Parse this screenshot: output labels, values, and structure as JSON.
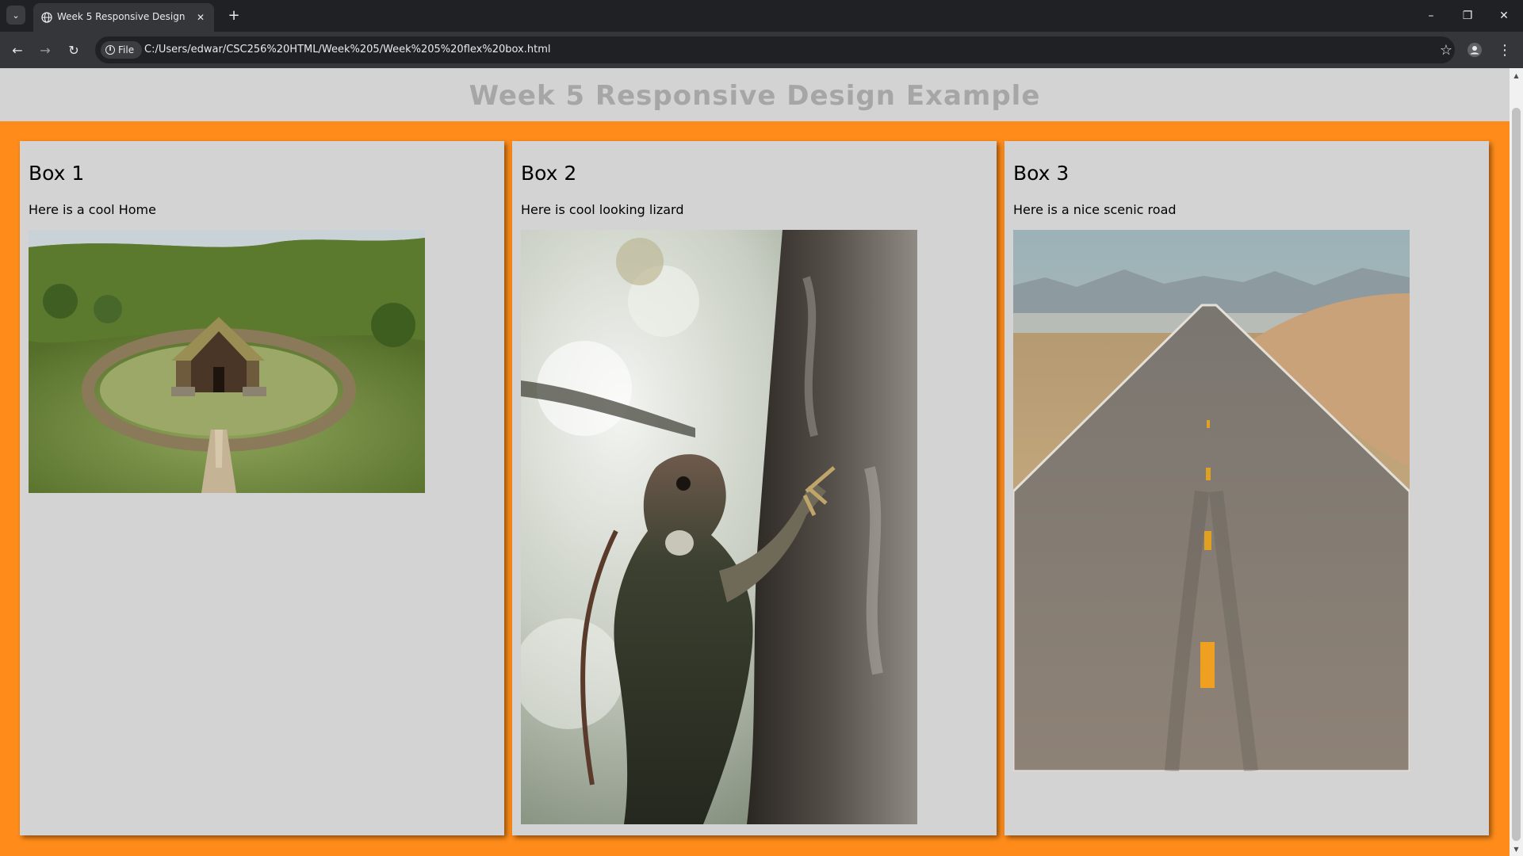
{
  "browser": {
    "tab_title": "Week 5 Responsive Design",
    "url_chip": "File",
    "url": "C:/Users/edwar/CSC256%20HTML/Week%205/Week%205%20flex%20box.html"
  },
  "page": {
    "heading": "Week 5 Responsive Design Example"
  },
  "boxes": [
    {
      "title": "Box 1",
      "caption": "Here is a cool Home",
      "image": "turf-house-photo"
    },
    {
      "title": "Box 2",
      "caption": "Here is cool looking lizard",
      "image": "iguana-photo"
    },
    {
      "title": "Box 3",
      "caption": "Here is a nice scenic road",
      "image": "desert-road-photo"
    }
  ],
  "colors": {
    "container_background": "#ff8c1a",
    "box_background": "#d3d3d3",
    "heading_color": "#a6a6a6"
  },
  "icons": {
    "back": "arrow-left-icon",
    "forward": "arrow-right-icon",
    "reload": "reload-icon",
    "bookmark": "star-icon",
    "profile": "person-icon",
    "menu": "kebab-menu-icon"
  }
}
